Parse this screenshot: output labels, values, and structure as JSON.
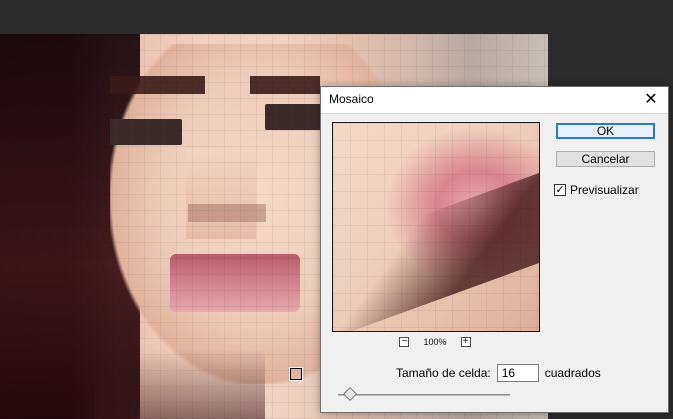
{
  "dialog": {
    "title": "Mosaico",
    "buttons": {
      "ok": "OK",
      "cancel": "Cancelar"
    },
    "preview": {
      "zoom_label": "100%",
      "zoom_minus": "−",
      "zoom_plus": "+"
    },
    "checkbox": {
      "label": "Previsualizar",
      "checked": true,
      "check_glyph": "✓"
    },
    "cell_size": {
      "label": "Tamaño de celda:",
      "value": "16",
      "unit": "cuadrados",
      "slider_fraction": 0.07
    },
    "close_glyph": "✕"
  }
}
